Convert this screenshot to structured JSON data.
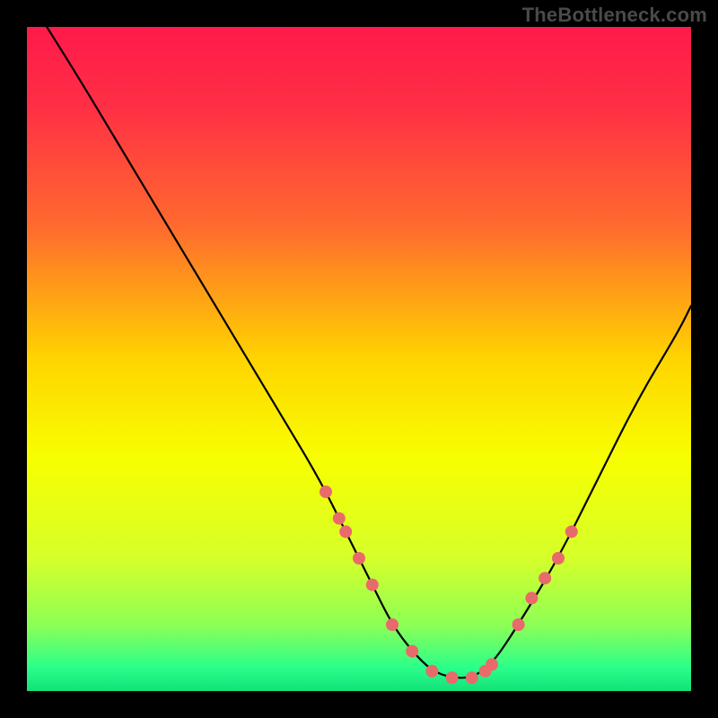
{
  "watermark": "TheBottleneck.com",
  "chart_data": {
    "type": "line",
    "title": "",
    "xlabel": "",
    "ylabel": "",
    "xlim": [
      0,
      100
    ],
    "ylim": [
      0,
      100
    ],
    "grid": false,
    "legend": false,
    "gradient_stops": [
      {
        "offset": 0,
        "color": "#ff1a4b"
      },
      {
        "offset": 0.12,
        "color": "#ff2f45"
      },
      {
        "offset": 0.3,
        "color": "#ff6a2e"
      },
      {
        "offset": 0.5,
        "color": "#ffd400"
      },
      {
        "offset": 0.65,
        "color": "#f7ff00"
      },
      {
        "offset": 0.8,
        "color": "#d6ff2a"
      },
      {
        "offset": 0.9,
        "color": "#8dff55"
      },
      {
        "offset": 0.965,
        "color": "#2bff8a"
      },
      {
        "offset": 1.0,
        "color": "#13e07a"
      }
    ],
    "series": [
      {
        "name": "bottleneck-curve",
        "x": [
          3,
          8,
          14,
          20,
          26,
          32,
          38,
          44,
          48,
          52,
          55,
          58,
          61,
          64,
          67,
          70,
          74,
          80,
          86,
          92,
          98,
          100
        ],
        "y": [
          100,
          92,
          82,
          72,
          62,
          52,
          42,
          32,
          24,
          16,
          10,
          6,
          3,
          2,
          2,
          4,
          10,
          20,
          32,
          44,
          54,
          58
        ]
      }
    ],
    "markers": {
      "name": "highlight-points",
      "color": "#e96a6a",
      "radius": 7,
      "x": [
        45,
        47,
        48,
        50,
        52,
        55,
        58,
        61,
        64,
        67,
        69,
        70,
        74,
        76,
        78,
        80,
        82
      ],
      "y": [
        30,
        26,
        24,
        20,
        16,
        10,
        6,
        3,
        2,
        2,
        3,
        4,
        10,
        14,
        17,
        20,
        24
      ]
    }
  }
}
